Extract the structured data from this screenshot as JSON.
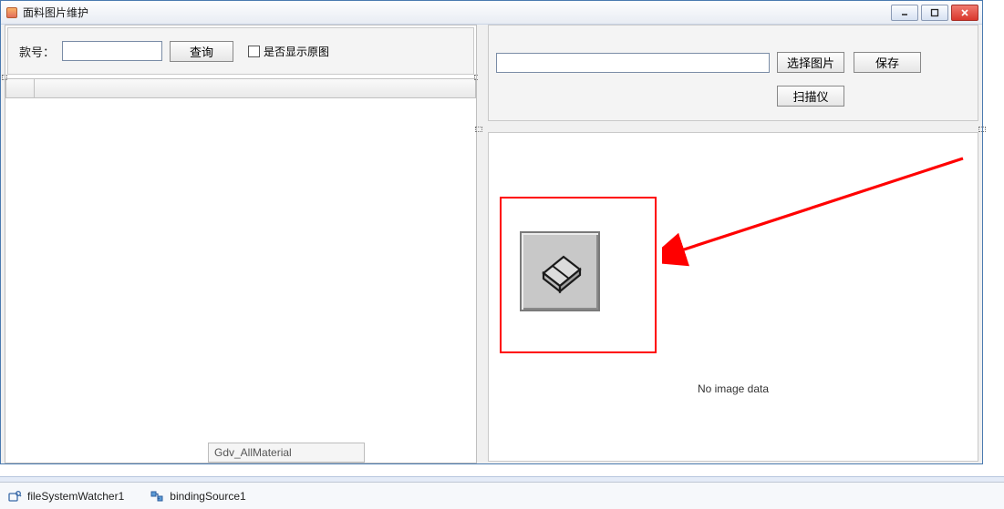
{
  "window": {
    "title": "面料图片维护"
  },
  "search": {
    "style_label": "款号：",
    "style_value": "",
    "query_label": "查询",
    "show_original_label": "是否显示原图"
  },
  "grid": {
    "floating_tag": "Gdv_AllMaterial"
  },
  "right_panel": {
    "path_value": "",
    "select_image_label": "选择图片",
    "save_label": "保存",
    "scanner_label": "扫描仪"
  },
  "preview": {
    "no_image_text": "No image data"
  },
  "tray": {
    "item1": "fileSystemWatcher1",
    "item2": "bindingSource1"
  },
  "icons": {
    "form": "form-icon",
    "minimize": "minimize-icon",
    "maximize": "maximize-icon",
    "close": "close-icon",
    "eraser": "eraser-icon",
    "watcher": "file-watcher-icon",
    "binding": "binding-source-icon"
  }
}
